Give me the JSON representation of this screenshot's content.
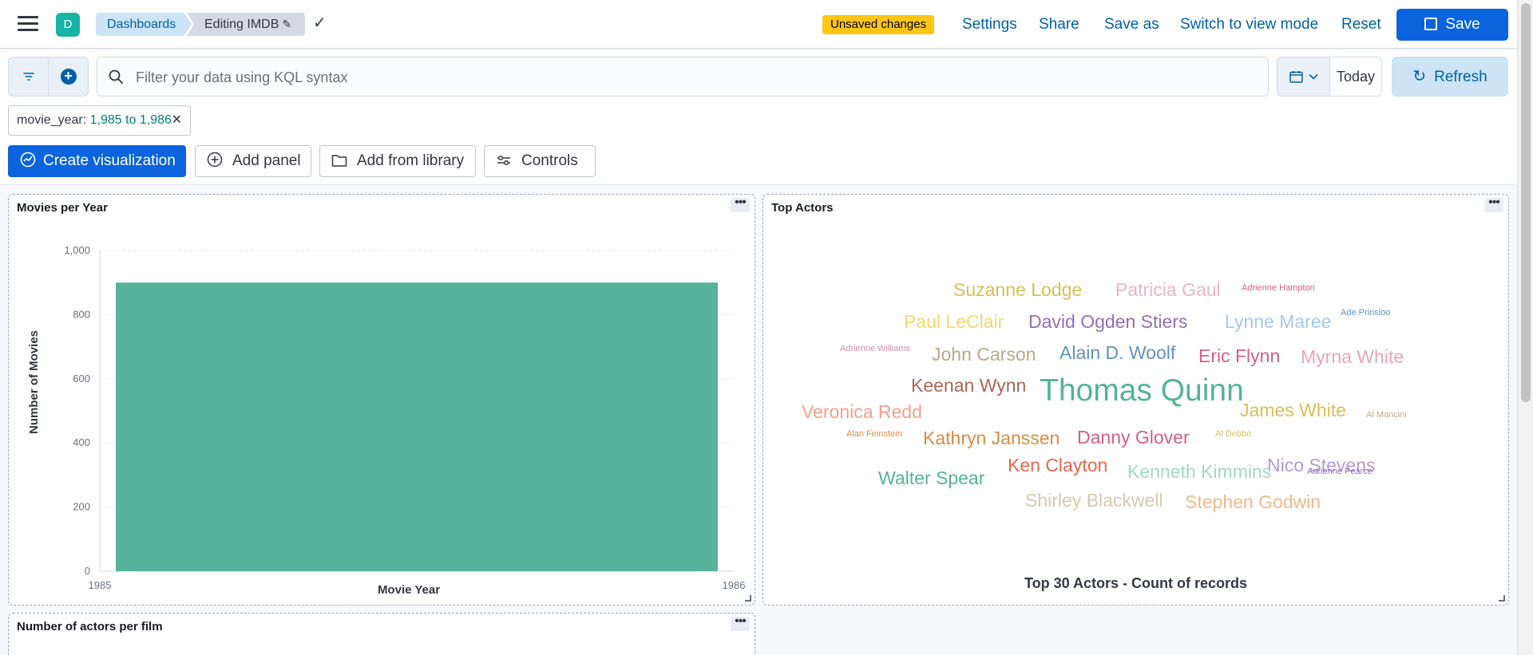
{
  "header": {
    "avatar_letter": "D",
    "breadcrumb_root": "Dashboards",
    "breadcrumb_current": "Editing IMDB",
    "unsaved_badge": "Unsaved changes",
    "links": [
      "Settings",
      "Share",
      "Save as",
      "Switch to view mode",
      "Reset"
    ],
    "save_label": "Save"
  },
  "query_bar": {
    "placeholder": "Filter your data using KQL syntax",
    "date_label": "Today",
    "refresh_label": "Refresh"
  },
  "filter_pill": {
    "field": "movie_year: ",
    "value": "1,985 to 1,986"
  },
  "actions": {
    "create_visualization": "Create visualization",
    "add_panel": "Add panel",
    "add_from_library": "Add from library",
    "controls": "Controls"
  },
  "panels": {
    "movies_per_year": {
      "title": "Movies per Year"
    },
    "top_actors": {
      "title": "Top Actors",
      "caption": "Top 30 Actors - Count of records"
    },
    "actors_per_film": {
      "title": "Number of actors per film"
    }
  },
  "chart_data": {
    "type": "bar",
    "title": "Movies per Year",
    "xlabel": "Movie Year",
    "ylabel": "Number of Movies",
    "x_ticks": [
      "1985",
      "1986"
    ],
    "y_ticks": [
      0,
      200,
      400,
      600,
      800,
      1000
    ],
    "y_tick_labels": [
      "0",
      "200",
      "400",
      "600",
      "800",
      "1,000"
    ],
    "ylim": [
      0,
      1000
    ],
    "series": [
      {
        "x_start": 1985,
        "x_end": 1986,
        "value": 900,
        "color": "#54b399"
      }
    ],
    "grid": true
  },
  "wordcloud": {
    "words": [
      {
        "text": "Suzanne Lodge",
        "color": "#d6bf57",
        "size": 1
      },
      {
        "text": "Patricia Gaul",
        "color": "#e7b6c9",
        "size": 1
      },
      {
        "text": "Adrienne Hampton",
        "color": "#d36086",
        "size": 0
      },
      {
        "text": "Paul LeClair",
        "color": "#f1d86f",
        "size": 1
      },
      {
        "text": "David Ogden Stiers",
        "color": "#9170b8",
        "size": 1
      },
      {
        "text": "Lynne Maree",
        "color": "#a6c8e8",
        "size": 1
      },
      {
        "text": "Ade Prinsloo",
        "color": "#6092c0",
        "size": 0
      },
      {
        "text": "Adrienne Williams",
        "color": "#ca8eae",
        "size": 0
      },
      {
        "text": "John Carson",
        "color": "#b9a888",
        "size": 1
      },
      {
        "text": "Alain D. Woolf",
        "color": "#6092c0",
        "size": 1
      },
      {
        "text": "Eric Flynn",
        "color": "#d36086",
        "size": 1
      },
      {
        "text": "Myrna White",
        "color": "#e7a5be",
        "size": 1
      },
      {
        "text": "Keenan Wynn",
        "color": "#aa6556",
        "size": 1
      },
      {
        "text": "Thomas Quinn",
        "color": "#54b399",
        "size": 2
      },
      {
        "text": "Veronica Redd",
        "color": "#f1a08e",
        "size": 1
      },
      {
        "text": "James White",
        "color": "#d6bf57",
        "size": 1
      },
      {
        "text": "Al Mancini",
        "color": "#b9a888",
        "size": 0
      },
      {
        "text": "Alan Feinstein",
        "color": "#da8b45",
        "size": 0
      },
      {
        "text": "Kathryn Janssen",
        "color": "#da8b45",
        "size": 1
      },
      {
        "text": "Danny Glover",
        "color": "#d36086",
        "size": 1
      },
      {
        "text": "Al Debbo",
        "color": "#d6bf57",
        "size": 0
      },
      {
        "text": "Nico Stevens",
        "color": "#b29bd6",
        "size": 1
      },
      {
        "text": "Ken Clayton",
        "color": "#e7664c",
        "size": 1
      },
      {
        "text": "Kenneth Kimmins",
        "color": "#9fd9c5",
        "size": 1
      },
      {
        "text": "Adrienne Pearce",
        "color": "#9170b8",
        "size": 0
      },
      {
        "text": "Walter Spear",
        "color": "#54b399",
        "size": 1
      },
      {
        "text": "Shirley Blackwell",
        "color": "#d8c9ad",
        "size": 1
      },
      {
        "text": "Stephen Godwin",
        "color": "#f0b98c",
        "size": 1
      }
    ]
  }
}
